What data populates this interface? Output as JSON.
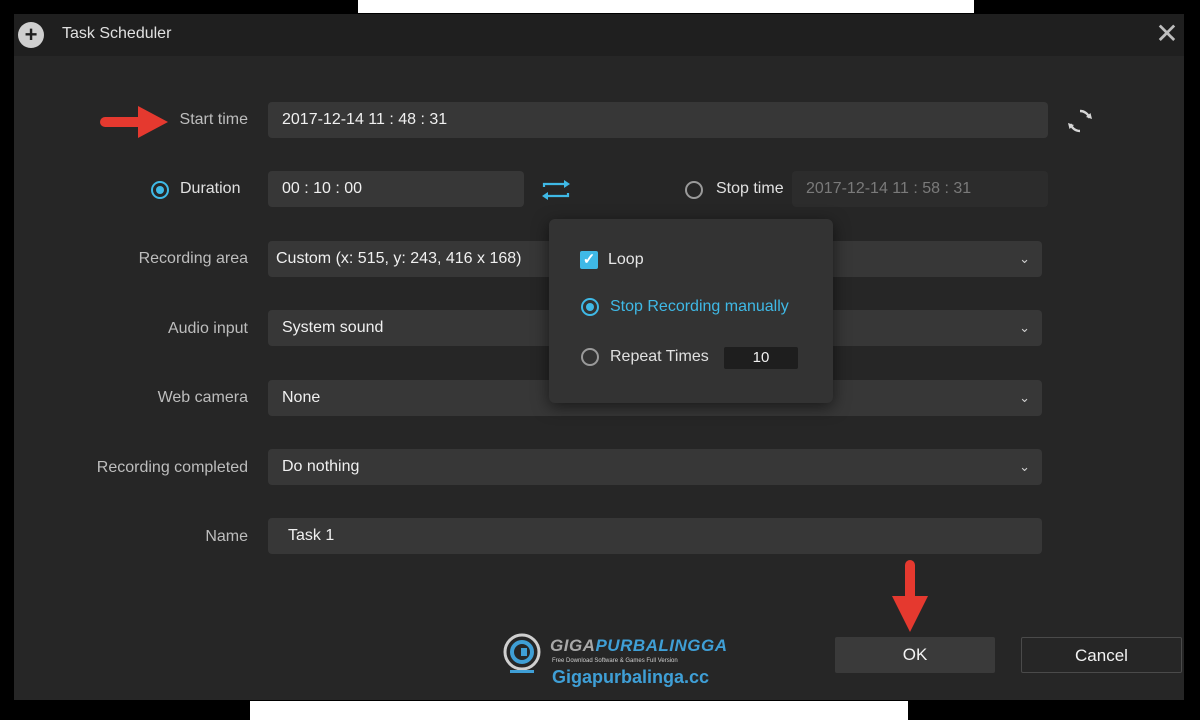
{
  "window": {
    "title": "Task Scheduler",
    "close_symbol": "✕"
  },
  "form": {
    "start_time": {
      "label": "Start time",
      "value": "2017-12-14 11 : 48 : 31"
    },
    "duration": {
      "label": "Duration",
      "value": "00 : 10 : 00",
      "selected": true
    },
    "stop_time": {
      "label": "Stop time",
      "value": "2017-12-14 11 : 58 : 31",
      "selected": false
    },
    "recording_area": {
      "label": "Recording area",
      "value": "Custom (x: 515, y: 243, 416 x 168)"
    },
    "audio_input": {
      "label": "Audio input",
      "value": "System sound"
    },
    "web_camera": {
      "label": "Web camera",
      "value": "None"
    },
    "recording_completed": {
      "label": "Recording completed",
      "value": "Do nothing"
    },
    "name": {
      "label": "Name",
      "value": "Task 1"
    }
  },
  "popup": {
    "loop": {
      "label": "Loop",
      "checked": true
    },
    "stop_manually": {
      "label": "Stop Recording manually",
      "selected": true
    },
    "repeat_times": {
      "label": "Repeat Times",
      "value": "10",
      "selected": false
    }
  },
  "buttons": {
    "ok": "OK",
    "cancel": "Cancel"
  },
  "watermark": {
    "brand_prefix": "GIGA",
    "brand_suffix": "PURBALINGGA",
    "tagline": "Free Download Software & Games Full Version",
    "site": "Gigapurbalinga.cc"
  },
  "icons": {
    "chevron": "⌄",
    "check": "✓",
    "refresh": "refresh-icon",
    "swap": "swap-icon"
  },
  "colors": {
    "accent": "#3fb9e6",
    "arrow": "#e5392f",
    "background": "#262626"
  }
}
